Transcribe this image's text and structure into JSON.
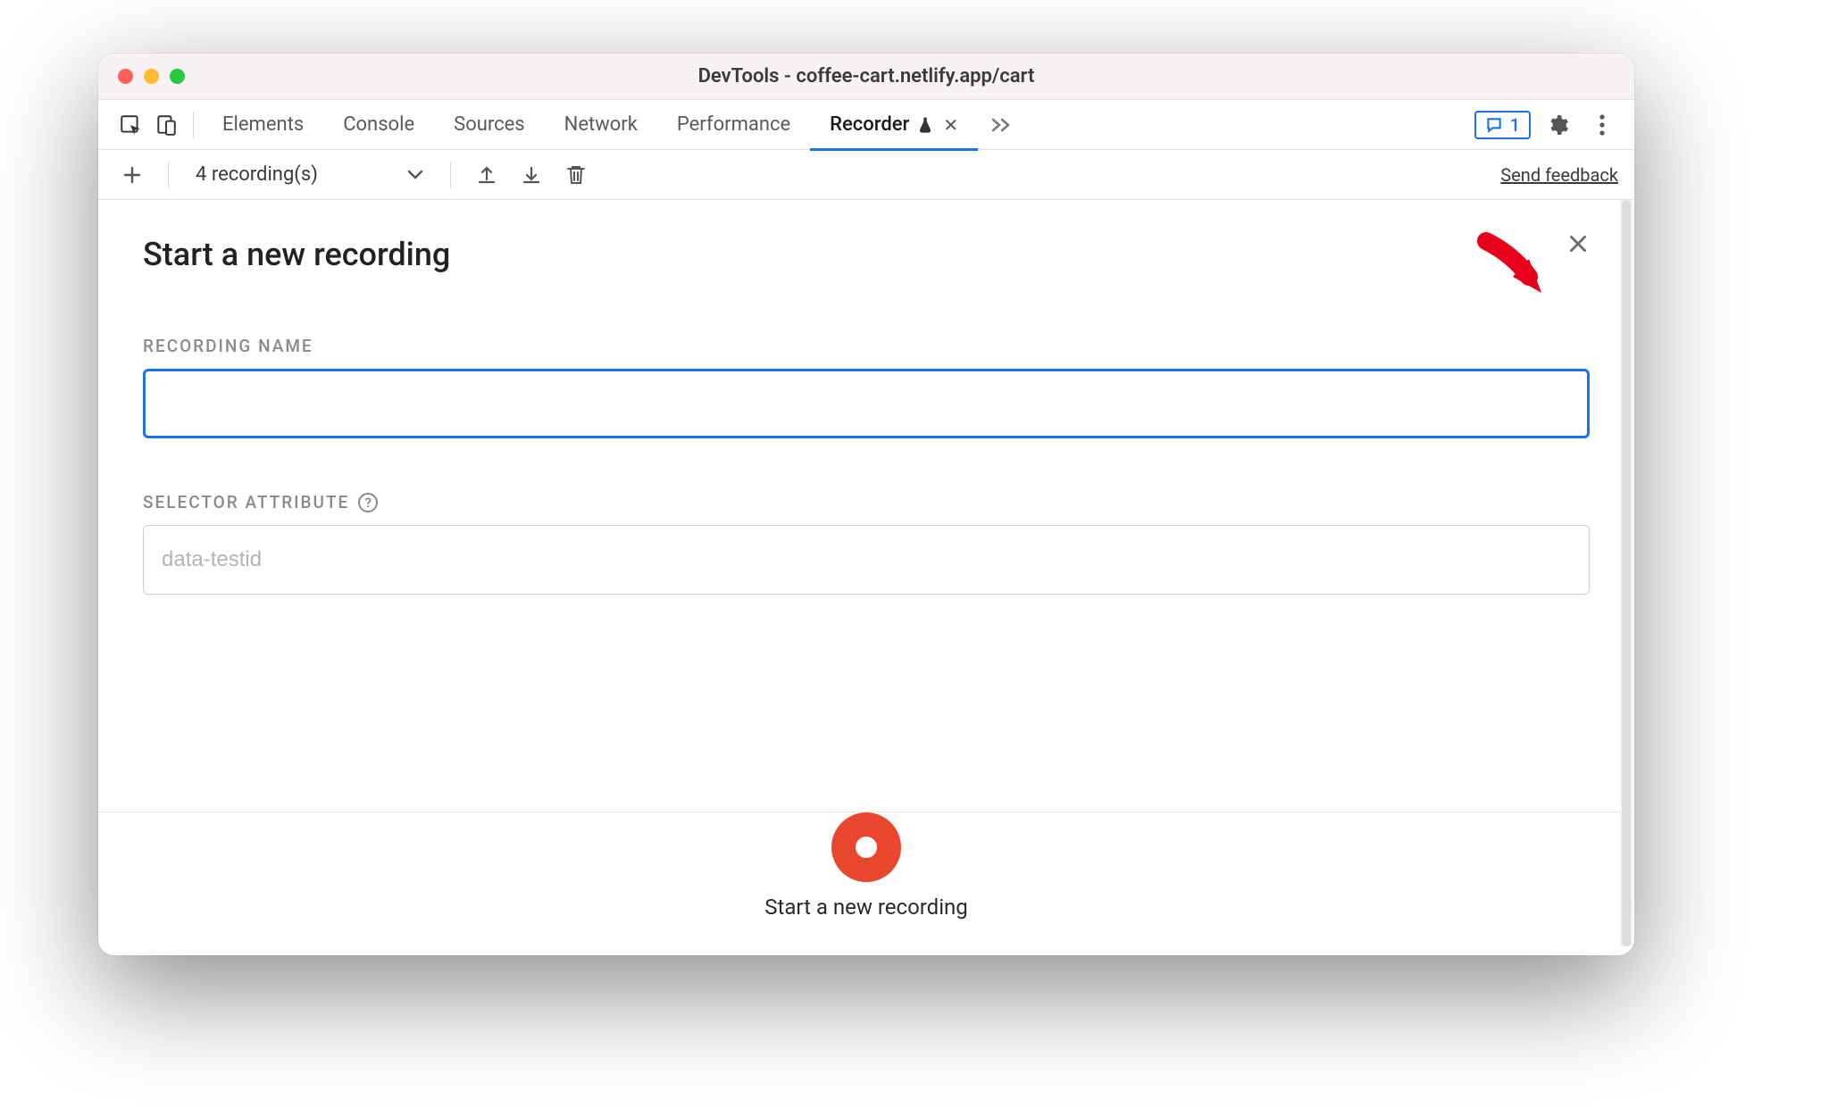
{
  "window": {
    "title": "DevTools - coffee-cart.netlify.app/cart"
  },
  "tabs": {
    "items": [
      "Elements",
      "Console",
      "Sources",
      "Network",
      "Performance",
      "Recorder"
    ],
    "active_index": 5
  },
  "issues": {
    "count": "1"
  },
  "subbar": {
    "recordings_label": "4 recording(s)",
    "feedback_label": "Send feedback"
  },
  "panel": {
    "title": "Start a new recording",
    "recording_name_label": "Recording Name",
    "recording_name_value": "",
    "selector_attribute_label": "Selector Attribute",
    "selector_attribute_placeholder": "data-testid",
    "selector_attribute_value": "",
    "action_label": "Start a new recording"
  }
}
